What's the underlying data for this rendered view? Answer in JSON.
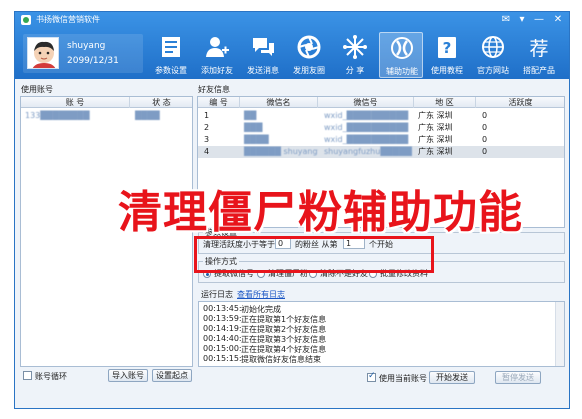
{
  "window": {
    "title": "书扬微信营销软件",
    "controls": [
      "✉",
      "▾",
      "—",
      "✕"
    ]
  },
  "profile": {
    "name": "shuyang",
    "date": "2099/12/31"
  },
  "toolbar": [
    {
      "label": "参数设置",
      "icon": "form-icon"
    },
    {
      "label": "添加好友",
      "icon": "add-user-icon"
    },
    {
      "label": "发送消息",
      "icon": "chat-icon"
    },
    {
      "label": "发朋友圈",
      "icon": "aperture-icon"
    },
    {
      "label": "分  享",
      "icon": "share-icon"
    },
    {
      "label": "辅助功能",
      "icon": "assist-icon",
      "active": true
    },
    {
      "label": "使用教程",
      "icon": "help-icon"
    },
    {
      "label": "官方网站",
      "icon": "globe-icon"
    },
    {
      "label": "搭配产品",
      "icon": "recommend-icon",
      "glyph": "荐"
    }
  ],
  "accounts": {
    "title": "使用账号",
    "columns": [
      "账  号",
      "状  态"
    ],
    "rows": [
      {
        "account": "133████████",
        "status": "████"
      }
    ]
  },
  "friends": {
    "title": "好友信息",
    "columns": [
      "编 号",
      "微信名",
      "微信号",
      "地  区",
      "活跃度"
    ],
    "rows": [
      {
        "no": "1",
        "name": "██",
        "wxid": "wxid_██████████",
        "region": "广东  深圳",
        "activity": "0"
      },
      {
        "no": "2",
        "name": "███",
        "wxid": "wxid_██████████",
        "region": "广东  深圳",
        "activity": "0"
      },
      {
        "no": "3",
        "name": "████",
        "wxid": "wxid_██████████",
        "region": "广东  深圳",
        "activity": "0"
      },
      {
        "no": "4",
        "name": "██████ shuyangfuzhu█████",
        "wxid": "shuyangfuzhu█████████",
        "region": "广东  深圳",
        "activity": "0",
        "selected": true
      }
    ]
  },
  "headline": "清理僵尸粉辅助功能",
  "params": {
    "title": "参数设置",
    "text_before": "清理活跃度小于等于",
    "threshold": "0",
    "text_mid": "的粉丝   从第",
    "start": "1",
    "text_after": "个开始"
  },
  "operation": {
    "title": "操作方式",
    "options": [
      {
        "label": "提取微信号",
        "checked": true
      },
      {
        "label": "清理僵尸粉",
        "checked": false
      },
      {
        "label": "清除不是好友",
        "checked": false
      },
      {
        "label": "批量修改资料",
        "checked": false
      }
    ]
  },
  "log": {
    "title": "运行日志",
    "link": "查看所有日志",
    "entries": [
      {
        "time": "00:13:45:",
        "msg": "初始化完成"
      },
      {
        "time": "00:13:59:",
        "msg": "正在提取第1个好友信息"
      },
      {
        "time": "00:14:19:",
        "msg": "正在提取第2个好友信息"
      },
      {
        "time": "00:14:40:",
        "msg": "正在提取第3个好友信息"
      },
      {
        "time": "00:15:00:",
        "msg": "正在提取第4个好友信息"
      },
      {
        "time": "00:15:15:",
        "msg": "提取微信好友信息结束"
      }
    ]
  },
  "bottom": {
    "loop_label": "账号循环",
    "import_button": "导入账号",
    "reset_button": "设置起点",
    "use_current_label": "使用当前账号",
    "start_button": "开始发送",
    "pause_button": "暂停发送"
  },
  "colors": {
    "titlebar": "#2b80d6",
    "accent": "#e8141b",
    "link": "#1a56c4"
  }
}
